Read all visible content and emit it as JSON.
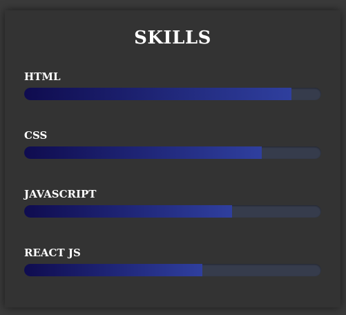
{
  "page": {
    "title": "SKILLS"
  },
  "colors": {
    "background": "#333333",
    "text": "#ffffff",
    "bar_track": "#363c4c",
    "bar_fill_start": "#0f0c4f",
    "bar_fill_end": "#2f3f9e"
  },
  "skills": [
    {
      "label": "HTML",
      "level_percent": 90
    },
    {
      "label": "CSS",
      "level_percent": 80
    },
    {
      "label": "JAVASCRIPT",
      "level_percent": 70
    },
    {
      "label": "REACT JS",
      "level_percent": 60
    }
  ]
}
